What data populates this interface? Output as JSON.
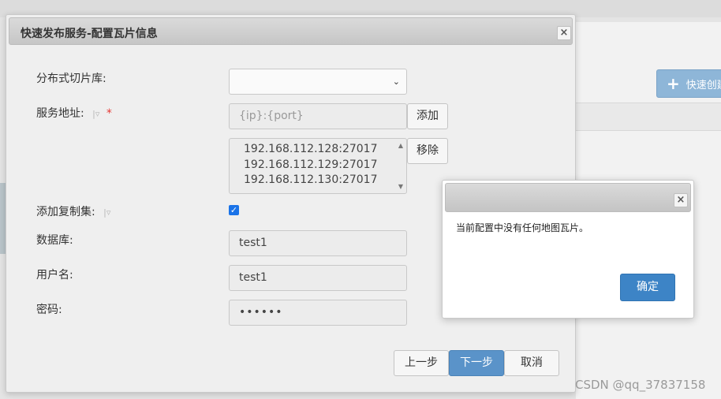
{
  "background": {
    "create_button_label": "快速创建"
  },
  "dialog": {
    "title": "快速发布服务-配置瓦片信息",
    "close_glyph": "×",
    "labels": {
      "tile_store": "分布式切片库:",
      "service_address": "服务地址:",
      "add_replica_set": "添加复制集:",
      "database": "数据库:",
      "username": "用户名:",
      "password": "密码:"
    },
    "hint_glyph": "|▿",
    "required_mark": "*",
    "tile_store_select": {
      "value": "",
      "caret": "⌄"
    },
    "service_address_input": {
      "placeholder": "{ip}:{port}"
    },
    "add_button": "添加",
    "remove_button": "移除",
    "address_list": [
      "192.168.112.128:27017",
      "192.168.112.129:27017",
      "192.168.112.130:27017"
    ],
    "replica_set_checked": true,
    "database_value": "test1",
    "username_value": "test1",
    "password_value": "••••••",
    "footer": {
      "prev_button": "上一步",
      "next_button": "下一步",
      "cancel_button": "取消"
    }
  },
  "alert": {
    "close_glyph": "×",
    "message": "当前配置中没有任何地图瓦片。",
    "ok_button": "确定"
  },
  "watermark": "CSDN @qq_37837158",
  "colors": {
    "primary_button": "#5a93c9",
    "ok_button": "#3d84c6",
    "required": "#e53935",
    "checkbox": "#1a73e8"
  }
}
